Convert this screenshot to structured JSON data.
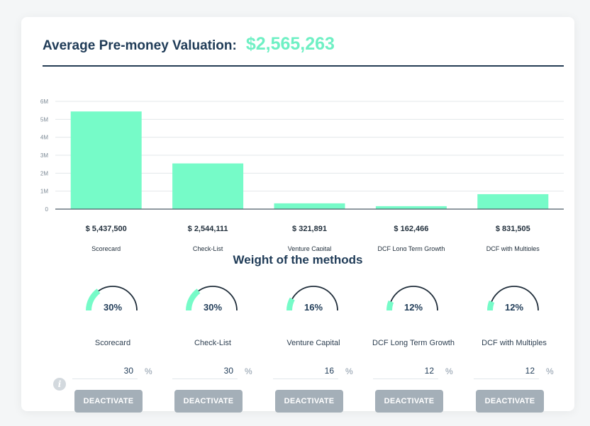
{
  "header": {
    "label": "Average Pre-money Valuation:",
    "value": "$2,565,263"
  },
  "chart_data": {
    "type": "bar",
    "categories": [
      "Scorecard",
      "Check-List",
      "Venture Capital",
      "DCF Long Term Growth",
      "DCF with Multiples"
    ],
    "values": [
      5437500,
      2544111,
      321891,
      162466,
      831505
    ],
    "value_labels": [
      "$ 5,437,500",
      "$ 2,544,111",
      "$ 321,891",
      "$ 162,466",
      "$ 831,505"
    ],
    "y_ticks": [
      "0",
      "1M",
      "2M",
      "3M",
      "4M",
      "5M",
      "6M"
    ],
    "ylim": [
      0,
      6000000
    ],
    "grid": true,
    "bar_color": "#76fbc8"
  },
  "weights": {
    "title": "Weight of the methods",
    "unit": "%",
    "items": [
      {
        "name": "Scorecard",
        "percent_label": "30%",
        "value": "30",
        "fraction": 0.3,
        "button": "DEACTIVATE"
      },
      {
        "name": "Check-List",
        "percent_label": "30%",
        "value": "30",
        "fraction": 0.3,
        "button": "DEACTIVATE"
      },
      {
        "name": "Venture Capital",
        "percent_label": "16%",
        "value": "16",
        "fraction": 0.16,
        "button": "DEACTIVATE"
      },
      {
        "name": "DCF Long Term Growth",
        "percent_label": "12%",
        "value": "12",
        "fraction": 0.12,
        "button": "DEACTIVATE"
      },
      {
        "name": "DCF with Multiples",
        "percent_label": "12%",
        "value": "12",
        "fraction": 0.12,
        "button": "DEACTIVATE"
      }
    ]
  },
  "info": {
    "icon": "info-icon",
    "glyph": "i"
  },
  "colors": {
    "accent": "#6ff0c4",
    "gauge_fill": "#76fbc8",
    "gauge_track": "#1f2d3a",
    "button": "#a4afb8",
    "title": "#1f3b57"
  }
}
